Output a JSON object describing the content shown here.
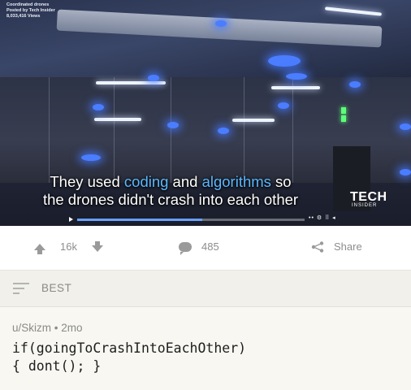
{
  "video": {
    "title_line": "Coordinated drones",
    "posted_line": "Posted by Tech Insider",
    "views_line": "8,033,416 Views",
    "caption_line1": {
      "pre": "They used ",
      "hl1": "coding",
      "mid": " and ",
      "hl2": "algorithms",
      "post": " so"
    },
    "caption_line2": "the drones didn't crash into each other",
    "brand": "TECH",
    "brand_sub": "INSIDER",
    "controls": "•• ⚙ ⠿ ◂",
    "progress": 0.55,
    "highlight_color": "#5bb8ff"
  },
  "actions": {
    "upvote_icon": "upvote-arrow",
    "score": "16k",
    "downvote_icon": "downvote-arrow",
    "comment_icon": "speech-bubble",
    "comments": "485",
    "share_icon": "share-nodes",
    "share_label": "Share"
  },
  "sort": {
    "icon": "sort-lines",
    "label": "BEST"
  },
  "comment": {
    "author": "u/Skizm",
    "separator": "•",
    "age": "2mo",
    "body_line1": "if(goingToCrashIntoEachOther)",
    "body_line2": "{ dont(); }"
  }
}
